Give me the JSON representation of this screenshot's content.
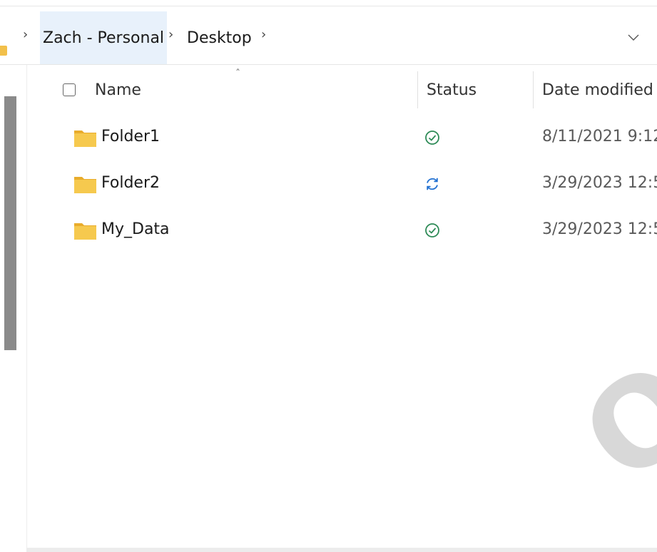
{
  "breadcrumb": {
    "items": [
      {
        "label": "Zach - Personal"
      },
      {
        "label": "Desktop"
      }
    ],
    "separator": "›"
  },
  "columns": {
    "name": "Name",
    "status": "Status",
    "date_modified": "Date modified"
  },
  "rows": [
    {
      "name": "Folder1",
      "status": "synced",
      "status_icon": "check-circle-icon",
      "date": "8/11/2021 9:12"
    },
    {
      "name": "Folder2",
      "status": "syncing",
      "status_icon": "sync-icon",
      "date": "3/29/2023 12:5"
    },
    {
      "name": "My_Data",
      "status": "synced",
      "status_icon": "check-circle-icon",
      "date": "3/29/2023 12:5"
    }
  ],
  "watermark": "OG",
  "colors": {
    "folder": "#f2c04a",
    "synced": "#2e8b57",
    "syncing": "#1f6fd1",
    "crumb_highlight": "#e8f1fb"
  }
}
